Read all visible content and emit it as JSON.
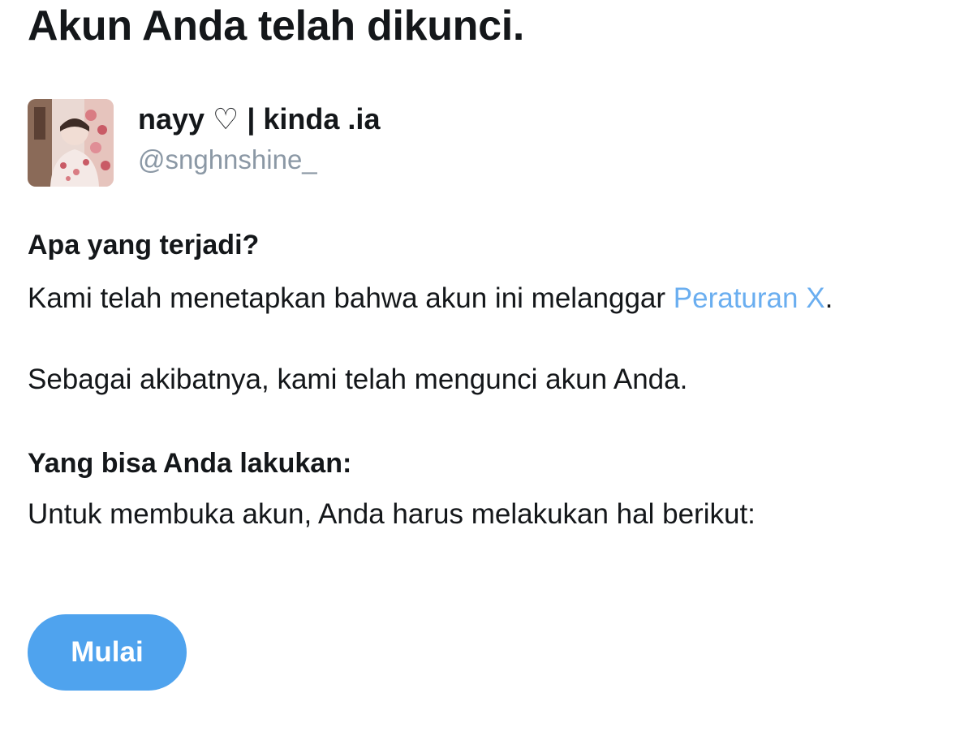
{
  "page": {
    "title": "Akun Anda telah dikunci."
  },
  "account": {
    "display_name": "nayy ♡ | kinda .ia",
    "handle": "@snghnshine_",
    "avatar": "profile-photo"
  },
  "what_happened": {
    "heading": "Apa yang terjadi?",
    "text_before_link": "Kami telah menetapkan bahwa akun ini melanggar ",
    "link_label": "Peraturan X",
    "text_after_link": ".",
    "consequence": "Sebagai akibatnya, kami telah mengunci akun Anda."
  },
  "what_you_can_do": {
    "heading": "Yang bisa Anda lakukan:",
    "text": "Untuk membuka akun, Anda harus melakukan hal berikut:"
  },
  "actions": {
    "start_label": "Mulai"
  },
  "colors": {
    "text": "#14171a",
    "muted": "#8b98a5",
    "link": "#6aaef0",
    "button": "#4fa3ee"
  }
}
